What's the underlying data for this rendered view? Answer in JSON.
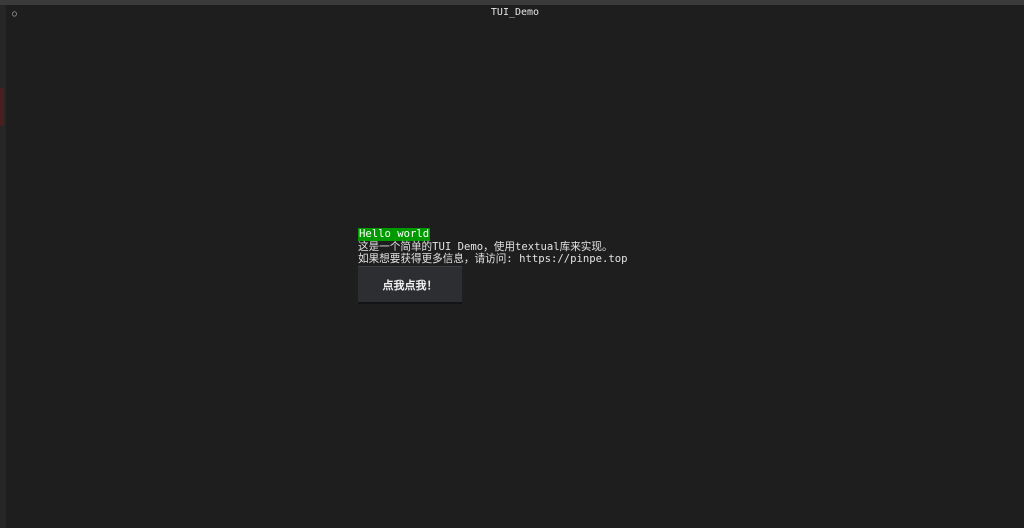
{
  "window": {
    "title": "TUI_Demo",
    "icon": "circle-icon"
  },
  "content": {
    "hello_label": "Hello world",
    "description": "这是一个简单的TUI Demo，使用textual库来实现。",
    "info_line": "如果想要获得更多信息，请访问: https://pinpe.top"
  },
  "button": {
    "label": "点我点我！"
  },
  "colors": {
    "background": "#1e1e1e",
    "hello_highlight": "#009a00",
    "button_bg": "#2d2e32",
    "text": "#e2e2e2"
  }
}
